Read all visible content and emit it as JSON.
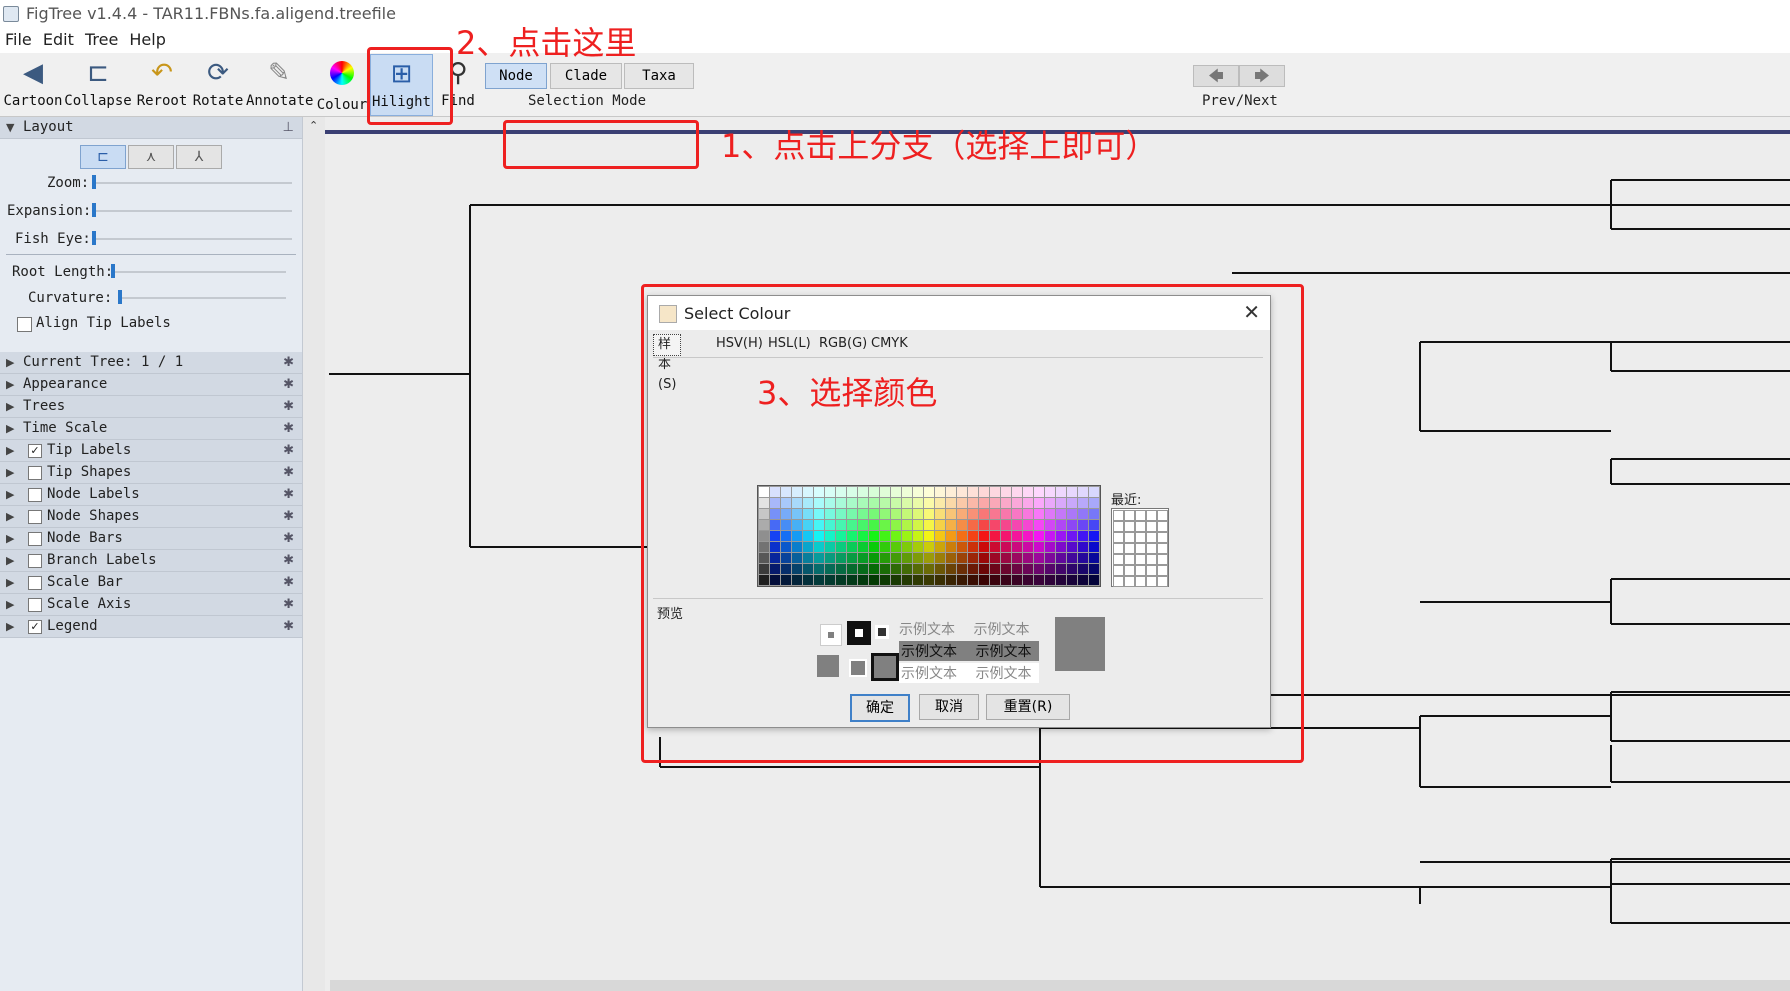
{
  "window": {
    "title": "FigTree v1.4.4 - TAR11.FBNs.fa.aligend.treefile"
  },
  "menu": [
    "File",
    "Edit",
    "Tree",
    "Help"
  ],
  "toolbar": {
    "tools": [
      {
        "label": "Cartoon",
        "icon": "cartoon-icon"
      },
      {
        "label": "Collapse",
        "icon": "collapse-icon"
      },
      {
        "label": "Reroot",
        "icon": "reroot-icon"
      },
      {
        "label": "Rotate",
        "icon": "rotate-icon"
      },
      {
        "label": "Annotate",
        "icon": "paperclip-icon"
      },
      {
        "label": "Colour",
        "icon": "colour-wheel-icon"
      },
      {
        "label": "Hilight",
        "icon": "hilight-icon"
      },
      {
        "label": "Find",
        "icon": "magnifier-icon"
      }
    ],
    "selection_modes": [
      "Node",
      "Clade",
      "Taxa"
    ],
    "selection_mode_label": "Selection Mode",
    "selected_mode": "Node",
    "prev_next_label": "Prev/Next"
  },
  "layout_panel": {
    "title": "Layout",
    "sliders": [
      {
        "label": "Zoom:",
        "value": 0
      },
      {
        "label": "Expansion:",
        "value": 0
      },
      {
        "label": "Fish Eye:",
        "value": 0
      },
      {
        "label": "Root Length:",
        "value": 0
      },
      {
        "label": "Curvature:",
        "value": 0
      }
    ],
    "align_tip_labels": "Align Tip Labels"
  },
  "sections": [
    {
      "label": "Current Tree: 1 / 1",
      "checkbox": null
    },
    {
      "label": "Appearance",
      "checkbox": null
    },
    {
      "label": "Trees",
      "checkbox": null
    },
    {
      "label": "Time Scale",
      "checkbox": null
    },
    {
      "label": "Tip Labels",
      "checkbox": true
    },
    {
      "label": "Tip Shapes",
      "checkbox": false
    },
    {
      "label": "Node Labels",
      "checkbox": false
    },
    {
      "label": "Node Shapes",
      "checkbox": false
    },
    {
      "label": "Node Bars",
      "checkbox": false
    },
    {
      "label": "Branch Labels",
      "checkbox": false
    },
    {
      "label": "Scale Bar",
      "checkbox": false
    },
    {
      "label": "Scale Axis",
      "checkbox": false
    },
    {
      "label": "Legend",
      "checkbox": true
    }
  ],
  "dialog": {
    "title": "Select Colour",
    "tabs": [
      "样本(S)",
      "HSV(H)",
      "HSL(L)",
      "RGB(G)",
      "CMYK"
    ],
    "recent_label": "最近:",
    "preview_label": "预览",
    "sample_text": "示例文本",
    "buttons": {
      "ok": "确定",
      "cancel": "取消",
      "reset": "重置(R)"
    },
    "preview_color": "#808080"
  },
  "annotations": {
    "step1": "1、点击上分支（选择上即可）",
    "step2": "2、点击这里",
    "step3": "3、选择颜色",
    "color": "#ee2020"
  },
  "colors": {
    "selected_branch": "#3a3f73",
    "canvas": "#ededed",
    "panel": "#e6ebf2"
  }
}
